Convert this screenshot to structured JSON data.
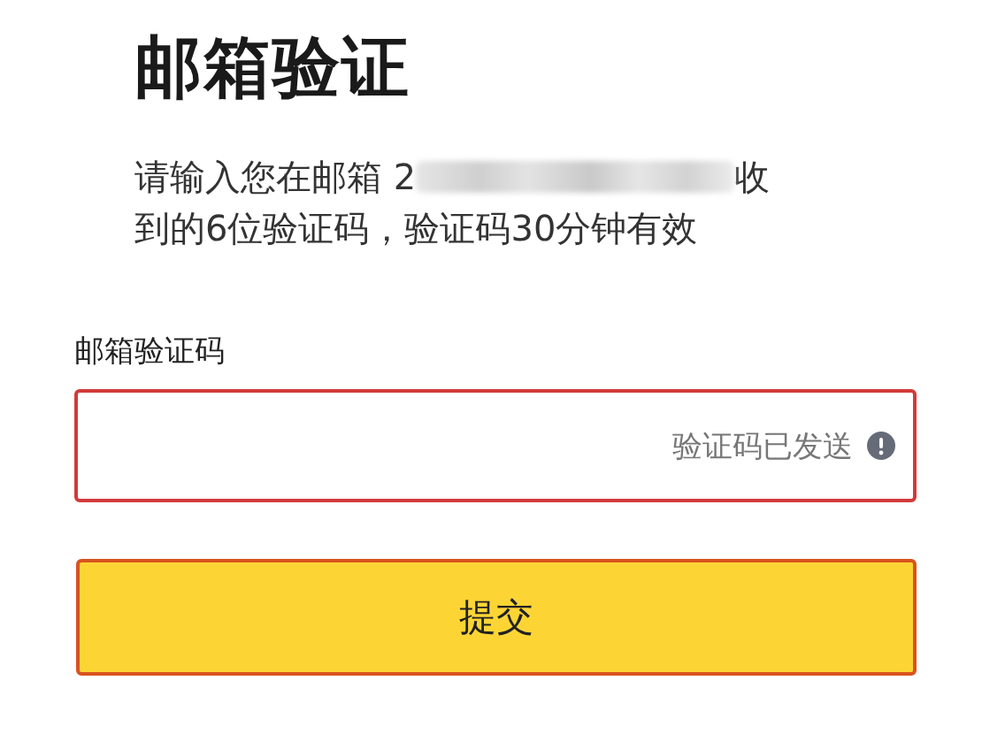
{
  "title": "邮箱验证",
  "intro": {
    "before": "请输入您在邮箱 2",
    "after": "收",
    "line_2": "到的6位验证码，验证码30分钟有效",
    "email_redacted": true
  },
  "field": {
    "label": "邮箱验证码",
    "status": "验证码已发送",
    "invalid": true
  },
  "button": {
    "label": "提交"
  }
}
